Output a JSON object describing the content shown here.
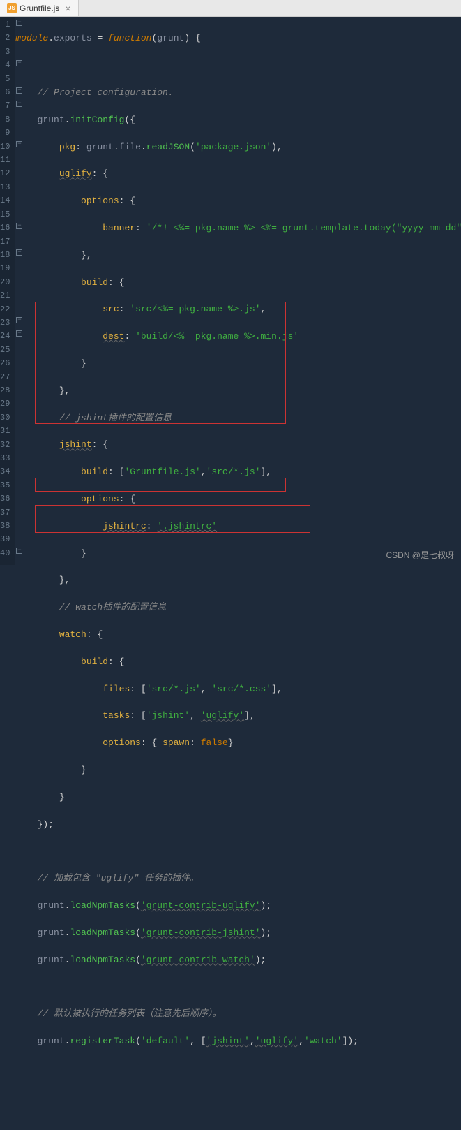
{
  "tab": {
    "filename": "Gruntfile.js",
    "icon": "JS"
  },
  "gutter": [
    "1",
    "2",
    "3",
    "4",
    "5",
    "6",
    "7",
    "8",
    "9",
    "10",
    "11",
    "12",
    "13",
    "14",
    "15",
    "16",
    "17",
    "18",
    "19",
    "20",
    "21",
    "22",
    "23",
    "24",
    "25",
    "26",
    "27",
    "28",
    "29",
    "30",
    "31",
    "32",
    "33",
    "34",
    "35",
    "36",
    "37",
    "38",
    "39",
    "40"
  ],
  "c": {
    "module": "module",
    "exports": "exports",
    "function": "function",
    "grunt": "grunt",
    "comment_proj": "// Project configuration.",
    "initConfig": "initConfig",
    "pkg": "pkg",
    "file": "file",
    "readJSON": "readJSON",
    "pkgjson": "'package.json'",
    "uglify": "uglify",
    "options": "options",
    "banner": "banner",
    "banner_str": "'/*! <%= pkg.name %> <%= grunt.template.today(\"yyyy-mm-dd\") %> */\\n'",
    "build": "build",
    "src": "src",
    "src_str": "'src/<%= pkg.name %>.js'",
    "dest": "dest",
    "dest_str": "'build/<%= pkg.name %>.min.js'",
    "comment_jshint": "// jshint插件的配置信息",
    "jshint": "jshint",
    "build_arr1": "'Gruntfile.js'",
    "build_arr2": "'src/*.js'",
    "jshintrc": "jshintrc",
    "jshintrc_str": "'.jshintrc'",
    "comment_watch": "// watch插件的配置信息",
    "watch": "watch",
    "files": "files",
    "files_arr1": "'src/*.js'",
    "files_arr2": "'src/*.css'",
    "tasks": "tasks",
    "tasks_arr1": "'jshint'",
    "tasks_arr2": "'uglify'",
    "spawn": "spawn",
    "false": "false",
    "comment_load": "// 加载包含 \"uglify\" 任务的插件。",
    "loadNpmTasks": "loadNpmTasks",
    "load1": "'grunt-contrib-uglify'",
    "load2": "'grunt-contrib-jshint'",
    "load3": "'grunt-contrib-watch'",
    "comment_default": "// 默认被执行的任务列表（注意先后顺序）。",
    "registerTask": "registerTask",
    "default": "'default'",
    "reg_arr1": "'jshint'",
    "reg_arr2": "'uglify'",
    "reg_arr3": "'watch'"
  },
  "watermark": "CSDN @是七叔呀"
}
